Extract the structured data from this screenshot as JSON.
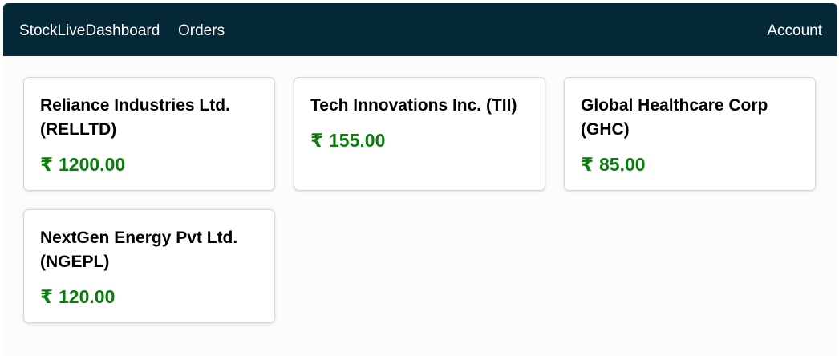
{
  "navbar": {
    "brand": "StockLiveDashboard",
    "orders": "Orders",
    "account": "Account",
    "background": "#042836"
  },
  "currency_symbol": "₹",
  "price_color": "#0b7d0b",
  "stocks": [
    {
      "name": "Reliance Industries Ltd. (RELLTD)",
      "price": "1200.00"
    },
    {
      "name": "Tech Innovations Inc. (TII)",
      "price": "155.00"
    },
    {
      "name": "Global Healthcare Corp (GHC)",
      "price": "85.00"
    },
    {
      "name": "NextGen Energy Pvt Ltd. (NGEPL)",
      "price": "120.00"
    }
  ]
}
